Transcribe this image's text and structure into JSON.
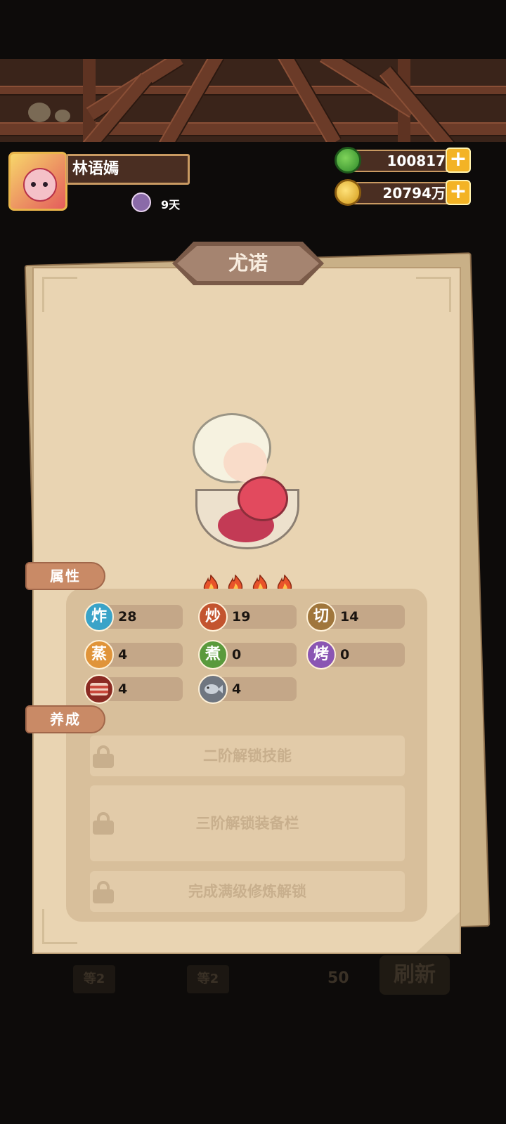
{
  "player": {
    "name": "林语嫣",
    "days": "9天"
  },
  "resources": {
    "jade": "100817",
    "coins": "20794万"
  },
  "panel": {
    "title": "尤诺",
    "stars": 4
  },
  "tabs": {
    "attributes": "属性",
    "training": "养成"
  },
  "stats": [
    {
      "glyph": "炸",
      "value": "28",
      "color": "#3aa3c8"
    },
    {
      "glyph": "炒",
      "value": "19",
      "color": "#c3542f"
    },
    {
      "glyph": "切",
      "value": "14",
      "color": "#a0763c"
    },
    {
      "glyph": "蒸",
      "value": "4",
      "color": "#e0943a"
    },
    {
      "glyph": "煮",
      "value": "0",
      "color": "#5a9a3c"
    },
    {
      "glyph": "烤",
      "value": "0",
      "color": "#8a55b3"
    },
    {
      "glyph": "",
      "value": "4",
      "icon": "meat-icon"
    },
    {
      "glyph": "",
      "value": "4",
      "icon": "fish-icon"
    }
  ],
  "locks": [
    "二阶解锁技能",
    "三阶解锁装备栏",
    "完成满级修炼解锁"
  ],
  "background": {
    "level_a": "等2",
    "level_b": "等2",
    "count": "50",
    "refresh": "刷新"
  }
}
